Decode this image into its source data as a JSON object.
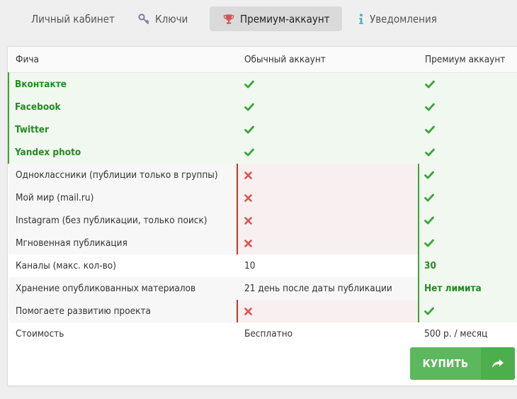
{
  "tabs": [
    {
      "label": "Личный кабинет",
      "icon": "user-icon"
    },
    {
      "label": "Ключи",
      "icon": "key-icon"
    },
    {
      "label": "Премиум-аккаунт",
      "icon": "trophy-icon",
      "active": true
    },
    {
      "label": "Уведомления",
      "icon": "info-icon"
    }
  ],
  "table": {
    "headers": [
      "Фича",
      "Обычный аккаунт",
      "Премиум аккаунт"
    ],
    "rows": [
      {
        "feature": "Вконтакте",
        "basic": "check",
        "premium": "check"
      },
      {
        "feature": "Facebook",
        "basic": "check",
        "premium": "check"
      },
      {
        "feature": "Twitter",
        "basic": "check",
        "premium": "check"
      },
      {
        "feature": "Yandex photo",
        "basic": "check",
        "premium": "check"
      },
      {
        "feature": "Одноклассники (публиции только в группы)",
        "basic": "cross",
        "premium": "check"
      },
      {
        "feature": "Мой мир (mail.ru)",
        "basic": "cross",
        "premium": "check"
      },
      {
        "feature": "Instagram (без публикации, только поиск)",
        "basic": "cross",
        "premium": "check"
      },
      {
        "feature": "Мгновенная публикация",
        "basic": "cross",
        "premium": "check"
      },
      {
        "feature": "Каналы (макс. кол-во)",
        "basic": "10",
        "premium": "30"
      },
      {
        "feature": "Хранение опубликованных материалов",
        "basic": "21 день после даты публикации",
        "premium": "Нет лимита"
      },
      {
        "feature": "Помогаете развитию проекта",
        "basic": "cross",
        "premium": "check"
      },
      {
        "feature": "Стоимость",
        "basic": "Бесплатно",
        "premium": "500 р. / месяц"
      }
    ]
  },
  "buy_button": {
    "label": "КУПИТЬ",
    "icon": "share-arrow-icon"
  },
  "colors": {
    "green": "#3aa53a",
    "red": "#d9534f",
    "button": "#5cb85c",
    "button_dark": "#4cae4c"
  }
}
